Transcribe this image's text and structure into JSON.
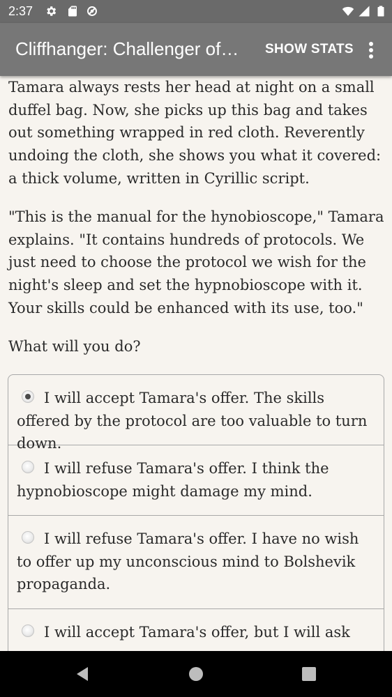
{
  "status_bar": {
    "time": "2:37",
    "icons": [
      "settings-icon",
      "sd-card-icon",
      "data-saver-icon",
      "wifi-icon",
      "signal-icon",
      "battery-icon"
    ]
  },
  "app_bar": {
    "title": "Cliffhanger: Challenger of…",
    "show_stats_label": "SHOW STATS",
    "menu_icon": "more-vert-icon"
  },
  "story": {
    "paragraphs": [
      "Tamara always rests her head at night on a small duffel bag. Now, she picks up this bag and takes out something wrapped in red cloth. Reverently undoing the cloth, she shows you what it covered: a thick volume, written in Cyrillic script.",
      "\"This is the manual for the hynobioscope,\" Tamara explains. \"It contains hundreds of protocols. We just need to choose the protocol we wish for the night's sleep and set the hypnobioscope with it. Your skills could be enhanced with its use, too.\""
    ],
    "prompt": "What will you do?"
  },
  "choices": [
    {
      "label": "I will accept Tamara's offer. The skills offered by the protocol are too valuable to turn down.",
      "selected": true
    },
    {
      "label": "I will refuse Tamara's offer. I think the hypnobioscope might damage my mind.",
      "selected": false
    },
    {
      "label": "I will refuse Tamara's offer. I have no wish to offer up my unconscious mind to Bolshevik propaganda.",
      "selected": false
    },
    {
      "label": "I will accept Tamara's offer, but I will ask",
      "selected": false
    }
  ],
  "nav_bar": {
    "icons": [
      "back-icon",
      "home-icon",
      "recents-icon"
    ]
  },
  "colors": {
    "status_bar": "#6a6a6a",
    "app_bar": "#777777",
    "background": "#f7f4ef",
    "text": "#2a2a2a",
    "choice_border": "#a8a8a8"
  }
}
